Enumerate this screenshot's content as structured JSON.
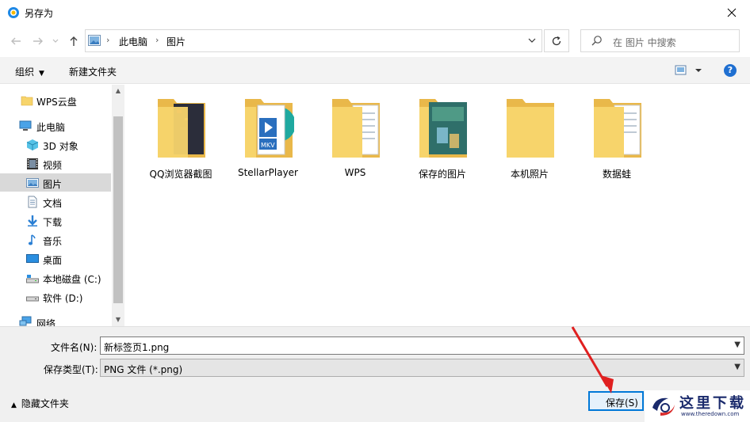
{
  "window": {
    "title": "另存为"
  },
  "address": {
    "segments": [
      "此电脑",
      "图片"
    ]
  },
  "search": {
    "placeholder": "在 图片 中搜索"
  },
  "toolbar": {
    "organize": "组织",
    "new_folder": "新建文件夹",
    "help": "?"
  },
  "sidebar": {
    "items": [
      {
        "label": "WPS云盘",
        "icon": "folder-icon"
      },
      {
        "label": "此电脑",
        "icon": "computer-icon"
      },
      {
        "label": "3D 对象",
        "icon": "cube-icon"
      },
      {
        "label": "视频",
        "icon": "film-icon"
      },
      {
        "label": "图片",
        "icon": "picture-icon",
        "selected": true
      },
      {
        "label": "文档",
        "icon": "document-icon"
      },
      {
        "label": "下载",
        "icon": "download-icon"
      },
      {
        "label": "音乐",
        "icon": "music-icon"
      },
      {
        "label": "桌面",
        "icon": "desktop-icon"
      },
      {
        "label": "本地磁盘 (C:)",
        "icon": "drive-icon"
      },
      {
        "label": "软件 (D:)",
        "icon": "drive-icon"
      },
      {
        "label": "网络",
        "icon": "network-icon"
      }
    ]
  },
  "folders": [
    {
      "label": "QQ浏览器截图",
      "preview": "dark-screenshot"
    },
    {
      "label": "StellarPlayer",
      "preview": "mkv-file"
    },
    {
      "label": "WPS",
      "preview": "documents"
    },
    {
      "label": "保存的图片",
      "preview": "game-image"
    },
    {
      "label": "本机照片",
      "preview": "empty"
    },
    {
      "label": "数据蛙",
      "preview": "documents"
    }
  ],
  "form": {
    "filename_label": "文件名(N):",
    "filename_value": "新标签页1.png",
    "filetype_label": "保存类型(T):",
    "filetype_value": "PNG 文件 (*.png)"
  },
  "footer": {
    "hide_folders": "隐藏文件夹",
    "save": "保存(S)"
  },
  "watermark": {
    "text": "这里下载",
    "url": "www.theredown.com"
  },
  "colors": {
    "accent": "#0078d7",
    "folder": "#f7d46b",
    "selection": "#d9d9d9",
    "arrow": "#e02020"
  }
}
